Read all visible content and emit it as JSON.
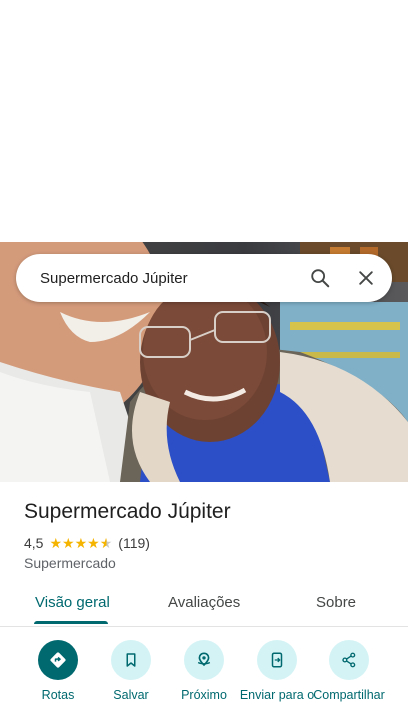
{
  "search": {
    "query": "Supermercado Júpiter"
  },
  "place": {
    "name": "Supermercado Júpiter",
    "rating": "4,5",
    "stars": 4.5,
    "reviews": "(119)",
    "category": "Supermercado"
  },
  "tabs": [
    {
      "label": "Visão geral",
      "active": true
    },
    {
      "label": "Avaliações",
      "active": false
    },
    {
      "label": "Sobre",
      "active": false
    }
  ],
  "actions": [
    {
      "label": "Rotas",
      "icon": "directions-icon"
    },
    {
      "label": "Salvar",
      "icon": "bookmark-icon"
    },
    {
      "label": "Próximo",
      "icon": "nearby-icon"
    },
    {
      "label": "Enviar para o",
      "icon": "send-to-phone-icon"
    },
    {
      "label": "Compartilhar",
      "icon": "share-icon"
    }
  ],
  "colors": {
    "accent": "#00696f",
    "accent_light": "#d4f3f5",
    "star": "#f5b400"
  }
}
